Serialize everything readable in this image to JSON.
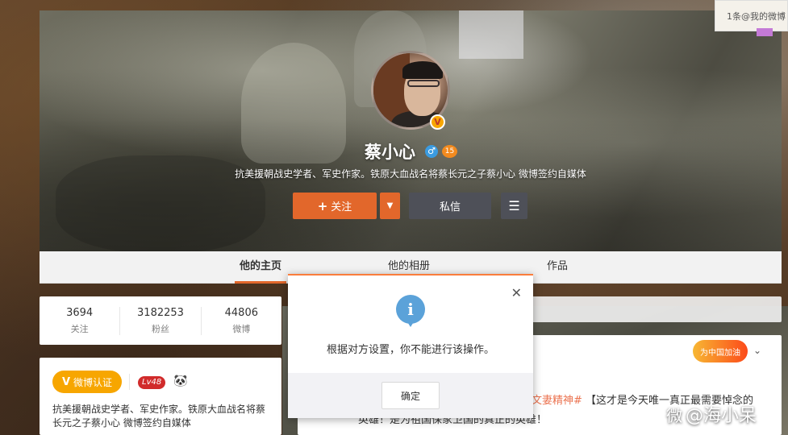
{
  "profile": {
    "name": "蔡小心",
    "gender_icon": "male-icon",
    "gender_symbol": "♂",
    "verified_symbol": "V",
    "bio": "抗美援朝战史学者、军史作家。铁原大血战名将蔡长元之子蔡小心 微博签约自媒体"
  },
  "actions": {
    "follow_label": "关注",
    "follow_plus": "+",
    "dropdown_symbol": "▼",
    "message_label": "私信",
    "more_symbol": "☰"
  },
  "tabs": [
    {
      "label": "他的主页",
      "active": true
    },
    {
      "label": "他的相册",
      "active": false
    },
    {
      "label": "作品",
      "active": false
    }
  ],
  "stats": [
    {
      "value": "3694",
      "label": "关注"
    },
    {
      "value": "3182253",
      "label": "粉丝"
    },
    {
      "value": "44806",
      "label": "微博"
    }
  ],
  "info": {
    "verified_label": "微博认证",
    "verified_v": "V",
    "level": "Lv48",
    "panda": "🐼",
    "description": "抗美援朝战史学者、军史作家。铁原大血战名将蔡长元之子蔡小心 微博签约自媒体"
  },
  "feed": {
    "campaign_label": "为中国加油",
    "chevron": "⌄",
    "line1_tag": "文妻精神#",
    "line1_rest": "【这才是今天唯一真正最需要悼念的",
    "line2": "英雄！是为祖国保家卫国的真正的英雄！"
  },
  "notice": {
    "text": "1条@我的微博"
  },
  "watermark": {
    "text": "@海小呆",
    "logo": "微"
  },
  "dialog": {
    "icon": "i",
    "close": "✕",
    "message": "根据对方设置，你不能进行该操作。",
    "ok_label": "确定"
  },
  "colors": {
    "accent": "#e2672b",
    "dialog_top": "#fa7d3c",
    "info_icon": "#5ba2d9",
    "verified": "#f7a600",
    "dark_button": "#4e5058"
  }
}
